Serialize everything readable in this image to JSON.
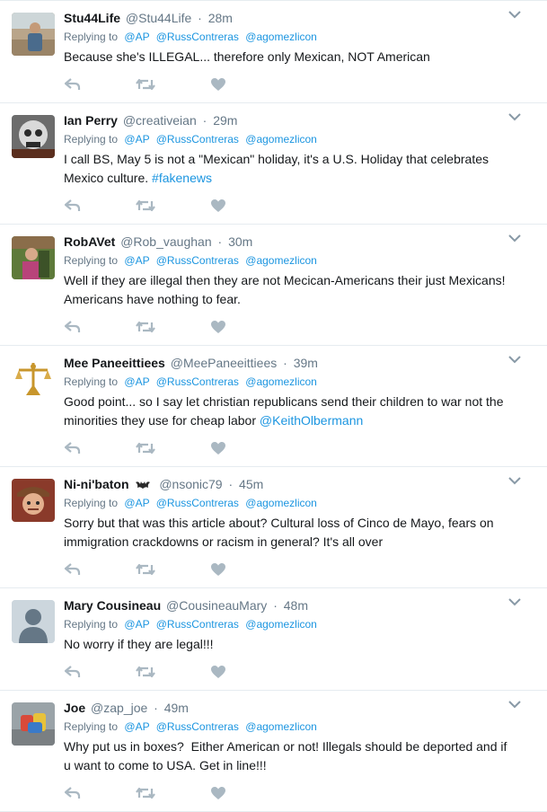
{
  "colors": {
    "link": "#1b95e0",
    "muted": "#657786",
    "text": "#14171a",
    "divider": "#e6ecf0",
    "action_icon": "#aab8c2"
  },
  "icons": [
    "reply-icon",
    "retweet-icon",
    "heart-icon",
    "caret-down-icon"
  ],
  "replying_label": "Replying to",
  "tweets": [
    {
      "name": "Stu44Life",
      "handle": "@Stu44Life",
      "time": "28m",
      "mentions": [
        "@AP",
        "@RussContreras",
        "@agomezlicon"
      ],
      "text": "Because she's ILLEGAL... therefore only Mexican, NOT American"
    },
    {
      "name": "Ian Perry",
      "handle": "@creativeian",
      "time": "29m",
      "mentions": [
        "@AP",
        "@RussContreras",
        "@agomezlicon"
      ],
      "text": "I call BS, May 5 is not a \"Mexican\" holiday, it's a U.S. Holiday that celebrates Mexico culture.",
      "hashtag": "#fakenews"
    },
    {
      "name": "RobAVet",
      "handle": "@Rob_vaughan",
      "time": "30m",
      "mentions": [
        "@AP",
        "@RussContreras",
        "@agomezlicon"
      ],
      "text": "Well if they are illegal then they are not Mecican-Americans their just Mexicans! Americans have nothing to fear."
    },
    {
      "name": "Mee Paneeittiees",
      "handle": "@MeePaneeittiees",
      "time": "39m",
      "mentions": [
        "@AP",
        "@RussContreras",
        "@agomezlicon"
      ],
      "text": "Good point... so I say let christian republicans send their children to war not the minorities they use for cheap labor",
      "trailing_mention": "@KeithOlbermann"
    },
    {
      "name": "Ni-ni'baton",
      "handle": "@nsonic79",
      "time": "45m",
      "mentions": [
        "@AP",
        "@RussContreras",
        "@agomezlicon"
      ],
      "text": "Sorry but that was this article about? Cultural loss of Cinco de Mayo, fears on immigration crackdowns or racism in general? It's all over"
    },
    {
      "name": "Mary Cousineau",
      "handle": "@CousineauMary",
      "time": "48m",
      "mentions": [
        "@AP",
        "@RussContreras",
        "@agomezlicon"
      ],
      "text": "No worry if they are legal!!!"
    },
    {
      "name": "Joe",
      "handle": "@zap_joe",
      "time": "49m",
      "mentions": [
        "@AP",
        "@RussContreras",
        "@agomezlicon"
      ],
      "text": "Why put us in boxes?  Either American or not! Illegals should be deported and if u want to come to USA. Get in line!!!"
    }
  ]
}
